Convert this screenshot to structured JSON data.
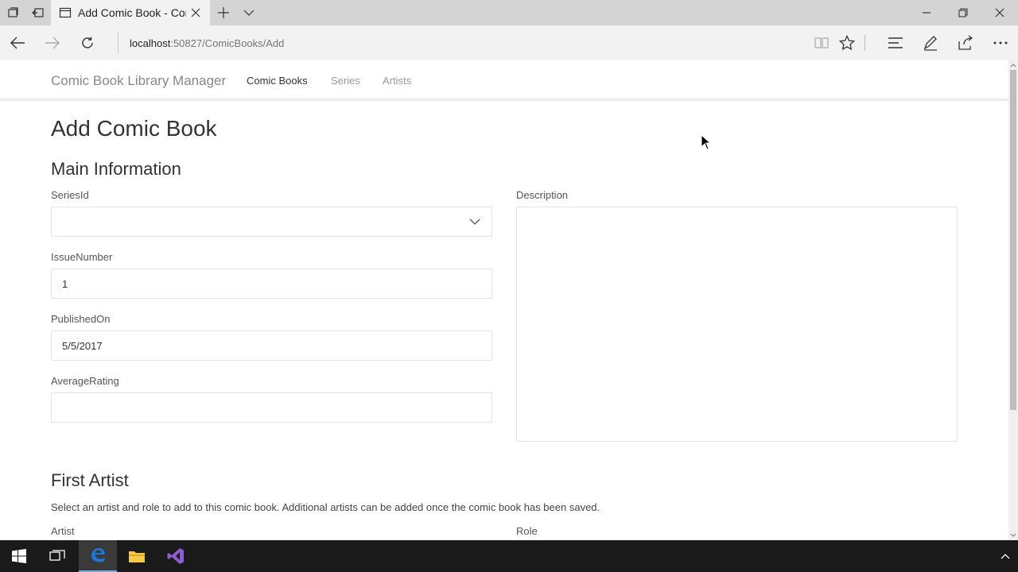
{
  "browser": {
    "tab_title": "Add Comic Book - Com",
    "url_host": "localhost",
    "url_path": ":50827/ComicBooks/Add"
  },
  "site": {
    "brand": "Comic Book Library Manager",
    "nav": [
      {
        "label": "Comic Books",
        "active": true
      },
      {
        "label": "Series",
        "active": false
      },
      {
        "label": "Artists",
        "active": false
      }
    ]
  },
  "page": {
    "title": "Add Comic Book",
    "main_section": "Main Information",
    "fields": {
      "series_id": {
        "label": "SeriesId",
        "value": ""
      },
      "issue_number": {
        "label": "IssueNumber",
        "value": "1"
      },
      "published_on": {
        "label": "PublishedOn",
        "value": "5/5/2017"
      },
      "average_rating": {
        "label": "AverageRating",
        "value": ""
      },
      "description": {
        "label": "Description",
        "value": ""
      }
    },
    "artist_section": "First Artist",
    "artist_help": "Select an artist and role to add to this comic book. Additional artists can be added once the comic book has been saved.",
    "artist_label": "Artist",
    "role_label": "Role"
  },
  "colors": {
    "accent": "#79a7d8",
    "taskbar": "#1a1a1a",
    "tabbar": "#d4d4d4",
    "edge_blue": "#1e78d7",
    "vs_purple": "#8f5bd0",
    "folder_yellow": "#f6c94a"
  },
  "icons": {
    "tab_actions": [
      "tab-sets-icon",
      "tab-aside-icon"
    ],
    "browser_tools": [
      "reading-view-icon",
      "favorite-star-icon",
      "hub-icon",
      "web-note-icon",
      "share-icon",
      "more-icon"
    ],
    "taskbar": [
      "windows-start-icon",
      "task-view-icon",
      "edge-icon",
      "file-explorer-icon",
      "visual-studio-icon"
    ]
  }
}
